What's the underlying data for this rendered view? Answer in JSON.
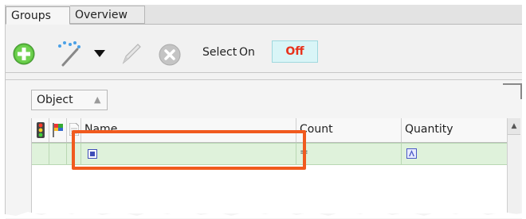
{
  "tabs": [
    {
      "label": "Groups",
      "active": true
    },
    {
      "label": "Overview",
      "active": false
    }
  ],
  "toolbar": {
    "icons": [
      "add-icon",
      "magic-wand-icon",
      "dropdown-caret-icon",
      "pencil-icon",
      "cancel-icon"
    ],
    "select_label": "Select",
    "on_label": "On",
    "off_label": "Off",
    "toggle_state": "Off"
  },
  "panel": {
    "object_button_label": "Object"
  },
  "grid": {
    "icon_columns": [
      "traffic-light-icon",
      "flag-icon",
      "document-icon"
    ],
    "columns": [
      "Name",
      "Count",
      "Quantity"
    ],
    "rows": [
      {
        "name_icon": "object-icon",
        "count": "=",
        "quantity_icon": "text-field-icon"
      }
    ]
  },
  "colors": {
    "toggle_bg": "#d9f5f7",
    "toggle_text": "#e8331d",
    "selected_row": "#dff2db",
    "highlight": "#f05a1e",
    "add_green": "#5bbf3f"
  }
}
